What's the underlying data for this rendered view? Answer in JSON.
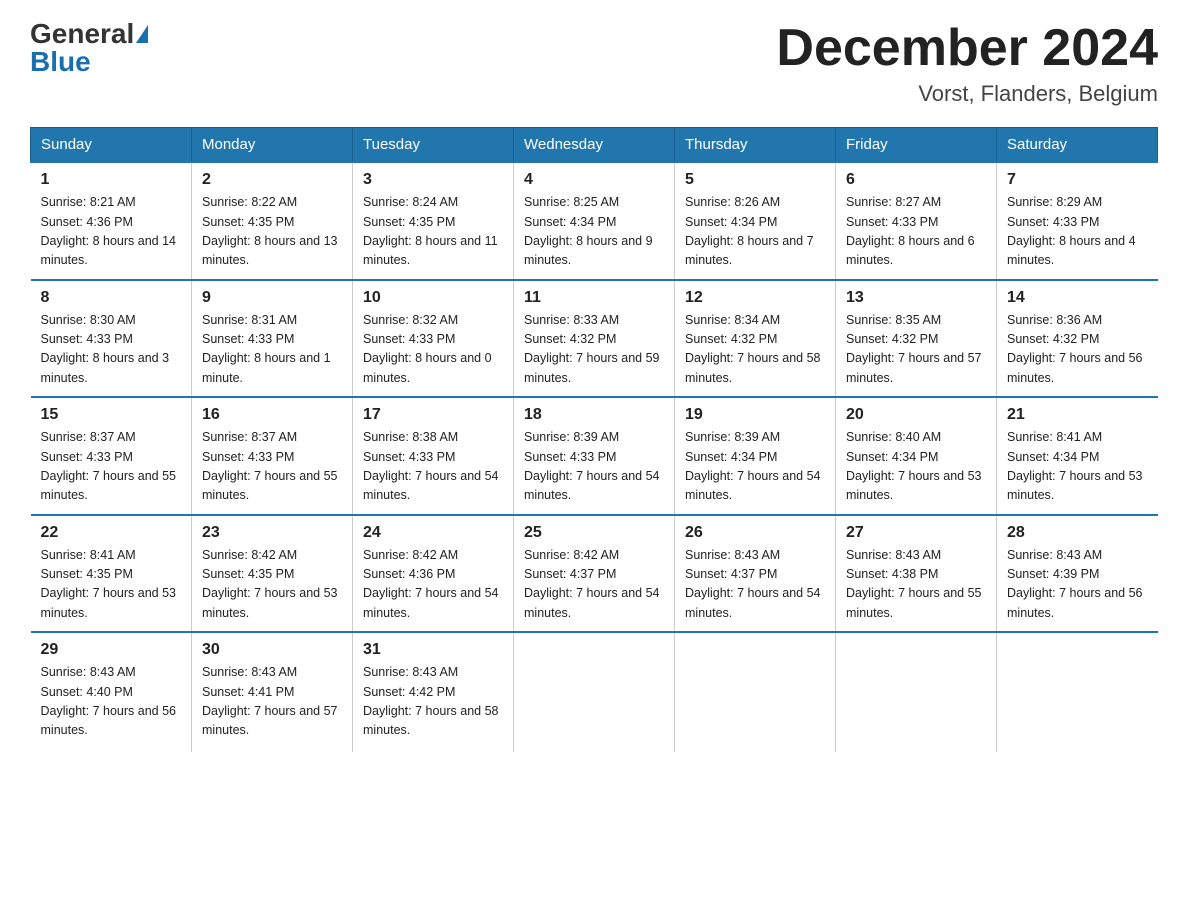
{
  "header": {
    "logo_general": "General",
    "logo_blue": "Blue",
    "month_title": "December 2024",
    "location": "Vorst, Flanders, Belgium"
  },
  "weekdays": [
    "Sunday",
    "Monday",
    "Tuesday",
    "Wednesday",
    "Thursday",
    "Friday",
    "Saturday"
  ],
  "weeks": [
    [
      {
        "day": "1",
        "sunrise": "8:21 AM",
        "sunset": "4:36 PM",
        "daylight": "8 hours and 14 minutes."
      },
      {
        "day": "2",
        "sunrise": "8:22 AM",
        "sunset": "4:35 PM",
        "daylight": "8 hours and 13 minutes."
      },
      {
        "day": "3",
        "sunrise": "8:24 AM",
        "sunset": "4:35 PM",
        "daylight": "8 hours and 11 minutes."
      },
      {
        "day": "4",
        "sunrise": "8:25 AM",
        "sunset": "4:34 PM",
        "daylight": "8 hours and 9 minutes."
      },
      {
        "day": "5",
        "sunrise": "8:26 AM",
        "sunset": "4:34 PM",
        "daylight": "8 hours and 7 minutes."
      },
      {
        "day": "6",
        "sunrise": "8:27 AM",
        "sunset": "4:33 PM",
        "daylight": "8 hours and 6 minutes."
      },
      {
        "day": "7",
        "sunrise": "8:29 AM",
        "sunset": "4:33 PM",
        "daylight": "8 hours and 4 minutes."
      }
    ],
    [
      {
        "day": "8",
        "sunrise": "8:30 AM",
        "sunset": "4:33 PM",
        "daylight": "8 hours and 3 minutes."
      },
      {
        "day": "9",
        "sunrise": "8:31 AM",
        "sunset": "4:33 PM",
        "daylight": "8 hours and 1 minute."
      },
      {
        "day": "10",
        "sunrise": "8:32 AM",
        "sunset": "4:33 PM",
        "daylight": "8 hours and 0 minutes."
      },
      {
        "day": "11",
        "sunrise": "8:33 AM",
        "sunset": "4:32 PM",
        "daylight": "7 hours and 59 minutes."
      },
      {
        "day": "12",
        "sunrise": "8:34 AM",
        "sunset": "4:32 PM",
        "daylight": "7 hours and 58 minutes."
      },
      {
        "day": "13",
        "sunrise": "8:35 AM",
        "sunset": "4:32 PM",
        "daylight": "7 hours and 57 minutes."
      },
      {
        "day": "14",
        "sunrise": "8:36 AM",
        "sunset": "4:32 PM",
        "daylight": "7 hours and 56 minutes."
      }
    ],
    [
      {
        "day": "15",
        "sunrise": "8:37 AM",
        "sunset": "4:33 PM",
        "daylight": "7 hours and 55 minutes."
      },
      {
        "day": "16",
        "sunrise": "8:37 AM",
        "sunset": "4:33 PM",
        "daylight": "7 hours and 55 minutes."
      },
      {
        "day": "17",
        "sunrise": "8:38 AM",
        "sunset": "4:33 PM",
        "daylight": "7 hours and 54 minutes."
      },
      {
        "day": "18",
        "sunrise": "8:39 AM",
        "sunset": "4:33 PM",
        "daylight": "7 hours and 54 minutes."
      },
      {
        "day": "19",
        "sunrise": "8:39 AM",
        "sunset": "4:34 PM",
        "daylight": "7 hours and 54 minutes."
      },
      {
        "day": "20",
        "sunrise": "8:40 AM",
        "sunset": "4:34 PM",
        "daylight": "7 hours and 53 minutes."
      },
      {
        "day": "21",
        "sunrise": "8:41 AM",
        "sunset": "4:34 PM",
        "daylight": "7 hours and 53 minutes."
      }
    ],
    [
      {
        "day": "22",
        "sunrise": "8:41 AM",
        "sunset": "4:35 PM",
        "daylight": "7 hours and 53 minutes."
      },
      {
        "day": "23",
        "sunrise": "8:42 AM",
        "sunset": "4:35 PM",
        "daylight": "7 hours and 53 minutes."
      },
      {
        "day": "24",
        "sunrise": "8:42 AM",
        "sunset": "4:36 PM",
        "daylight": "7 hours and 54 minutes."
      },
      {
        "day": "25",
        "sunrise": "8:42 AM",
        "sunset": "4:37 PM",
        "daylight": "7 hours and 54 minutes."
      },
      {
        "day": "26",
        "sunrise": "8:43 AM",
        "sunset": "4:37 PM",
        "daylight": "7 hours and 54 minutes."
      },
      {
        "day": "27",
        "sunrise": "8:43 AM",
        "sunset": "4:38 PM",
        "daylight": "7 hours and 55 minutes."
      },
      {
        "day": "28",
        "sunrise": "8:43 AM",
        "sunset": "4:39 PM",
        "daylight": "7 hours and 56 minutes."
      }
    ],
    [
      {
        "day": "29",
        "sunrise": "8:43 AM",
        "sunset": "4:40 PM",
        "daylight": "7 hours and 56 minutes."
      },
      {
        "day": "30",
        "sunrise": "8:43 AM",
        "sunset": "4:41 PM",
        "daylight": "7 hours and 57 minutes."
      },
      {
        "day": "31",
        "sunrise": "8:43 AM",
        "sunset": "4:42 PM",
        "daylight": "7 hours and 58 minutes."
      },
      null,
      null,
      null,
      null
    ]
  ]
}
